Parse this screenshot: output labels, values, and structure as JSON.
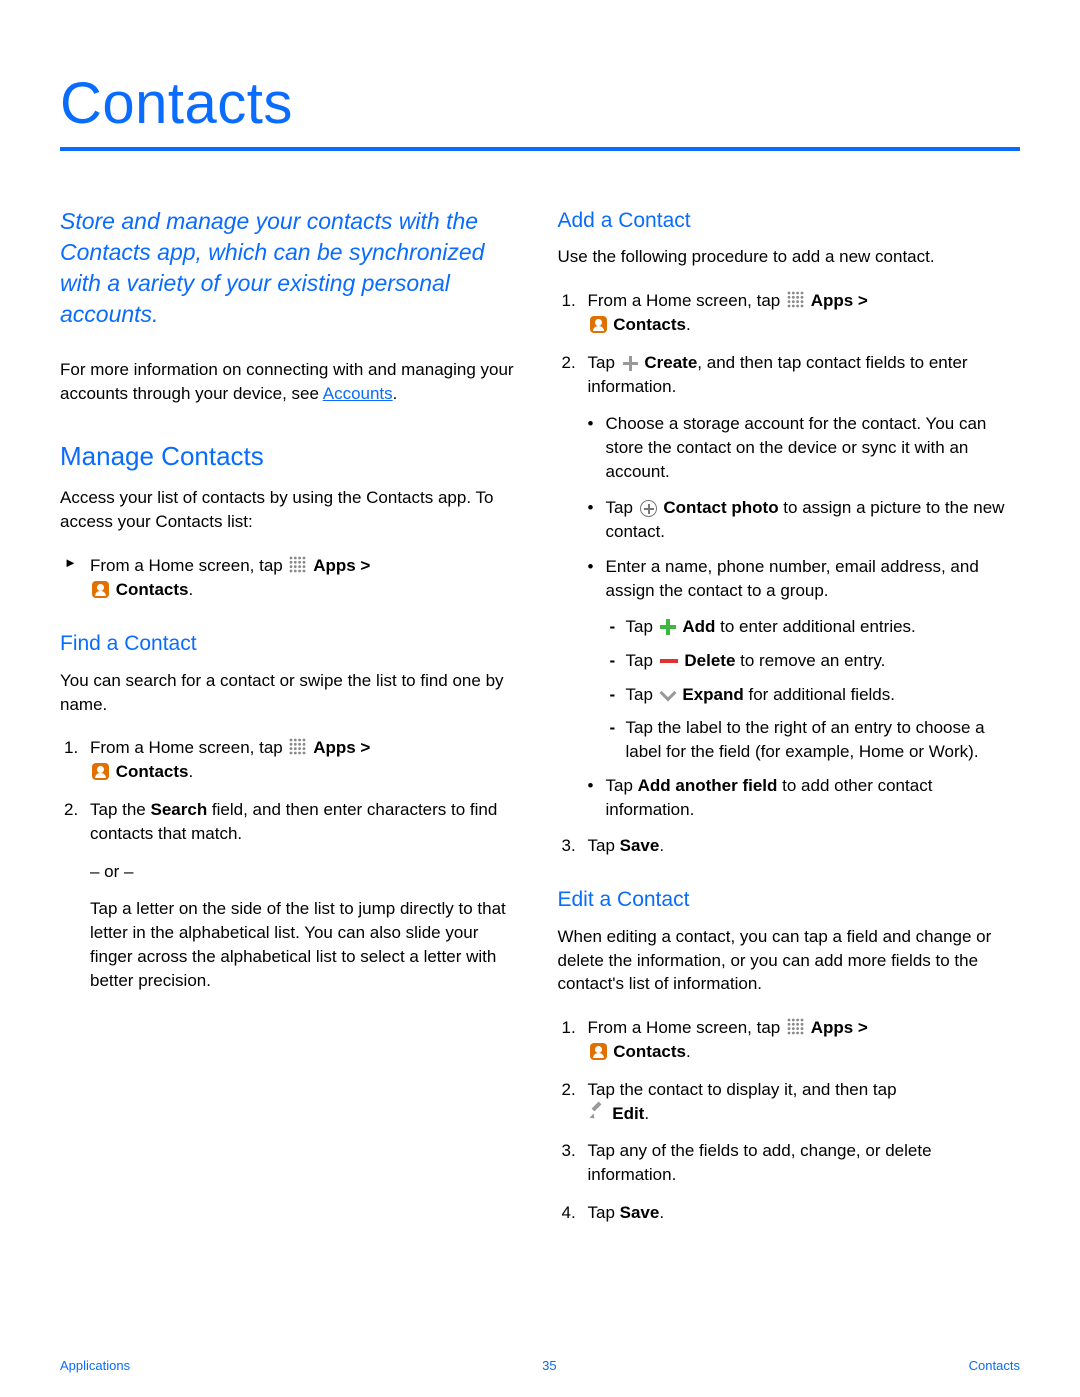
{
  "title": "Contacts",
  "intro": "Store and manage your contacts with the Contacts app, which can be synchronized with a variety of your existing personal accounts.",
  "more_info_prefix": "For more information on connecting with and managing your accounts through your device, see ",
  "more_info_link": "Accounts",
  "more_info_suffix": ".",
  "manage": {
    "heading": "Manage Contacts",
    "text": "Access your list of contacts by using the Contacts app. To access your Contacts list:",
    "step_prefix": "From a Home screen, tap ",
    "apps_label": "Apps",
    "gt": " > ",
    "contacts_label": "Contacts",
    "period": "."
  },
  "find": {
    "heading": "Find a Contact",
    "text": "You can search for a contact or swipe the list to find one by name.",
    "s1_prefix": "From a Home screen, tap ",
    "s2a": "Tap the ",
    "s2b": "Search",
    "s2c": " field, and then enter characters to find contacts that match.",
    "or": "– or –",
    "alt": "Tap a letter on the side of the list to jump directly to that letter in the alphabetical list. You can also slide your finger across the alphabetical list to select a letter with better precision."
  },
  "add": {
    "heading": "Add a Contact",
    "text": "Use the following procedure to add a new contact.",
    "s1_prefix": "From a Home screen, tap ",
    "s2a": "Tap ",
    "s2b": "Create",
    "s2c": ", and then tap contact fields to enter information.",
    "b1": "Choose a storage account for the contact. You can store the contact on the device or sync it with an account.",
    "b2a": "Tap ",
    "b2b": "Contact photo",
    "b2c": " to assign a picture to the new contact.",
    "b3": "Enter a name, phone number, email address, and assign the contact to a group.",
    "d1a": "Tap ",
    "d1b": "Add",
    "d1c": " to enter additional entries.",
    "d2a": "Tap ",
    "d2b": "Delete",
    "d2c": " to remove an entry.",
    "d3a": "Tap ",
    "d3b": "Expand",
    "d3c": " for additional fields.",
    "d4": "Tap the label to the right of an entry to choose a label for the field (for example, Home or Work).",
    "b4a": "Tap ",
    "b4b": "Add another field",
    "b4c": " to add other contact information.",
    "s3a": "Tap ",
    "s3b": "Save",
    "s3c": "."
  },
  "edit": {
    "heading": "Edit a Contact",
    "text": "When editing a contact, you can tap a field and change or delete the information, or you can add more fields to the contact's list of information.",
    "s1_prefix": "From a Home screen, tap ",
    "s2a": "Tap the contact to display it, and then tap ",
    "s2b": "Edit",
    "s2c": ".",
    "s3": "Tap any of the fields to add, change, or delete information.",
    "s4a": "Tap ",
    "s4b": "Save",
    "s4c": "."
  },
  "footer": {
    "left": "Applications",
    "center": "35",
    "right": "Contacts"
  }
}
